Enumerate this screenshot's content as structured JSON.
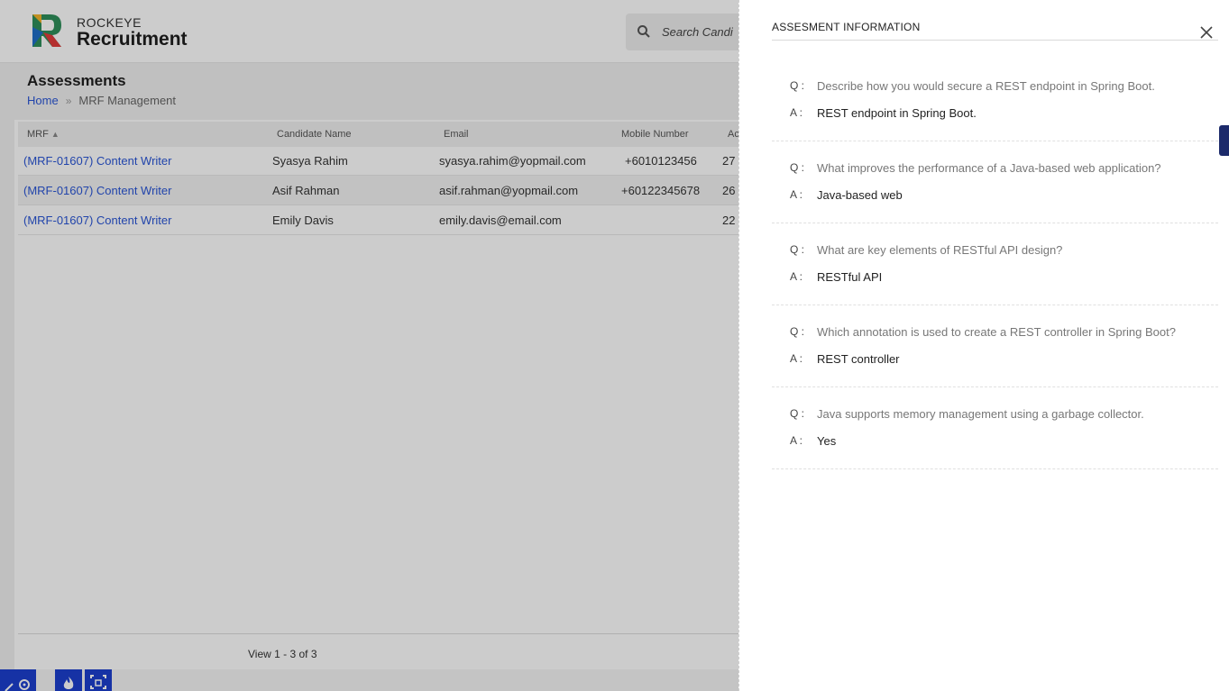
{
  "header": {
    "brand_top": "ROCKEYE",
    "brand_main": "Recruitment",
    "search_placeholder": "Search Candi"
  },
  "page": {
    "title": "Assessments",
    "breadcrumb": {
      "home": "Home",
      "current": "MRF Management"
    }
  },
  "table": {
    "columns": [
      "MRF",
      "Candidate Name",
      "Email",
      "Mobile Number",
      "Ac"
    ],
    "rows": [
      {
        "mrf": "(MRF-01607) Content Writer",
        "name": "Syasya Rahim",
        "email": "syasya.rahim@yopmail.com",
        "mobile": "+6010123456",
        "extra": "27 "
      },
      {
        "mrf": "(MRF-01607) Content Writer",
        "name": "Asif Rahman",
        "email": "asif.rahman@yopmail.com",
        "mobile": "+60122345678",
        "extra": "26 "
      },
      {
        "mrf": "(MRF-01607) Content Writer",
        "name": "Emily Davis",
        "email": "emily.davis@email.com",
        "mobile": "",
        "extra": "22 "
      }
    ],
    "pager": "View 1 - 3 of 3"
  },
  "drawer": {
    "title": "ASSESMENT INFORMATION",
    "q_label": "Q :",
    "a_label": "A :",
    "items": [
      {
        "q": "Describe how you would secure a REST endpoint in Spring Boot.",
        "a": "REST endpoint in Spring Boot."
      },
      {
        "q": "What improves the performance of a Java-based web application?",
        "a": "Java-based web"
      },
      {
        "q": "What are key elements of RESTful API design?",
        "a": "RESTful API"
      },
      {
        "q": "Which annotation is used to create a REST controller in Spring Boot?",
        "a": "REST controller"
      },
      {
        "q": "Java supports memory management using a garbage collector.",
        "a": "Yes"
      }
    ]
  },
  "colors": {
    "accent": "#2a56d6",
    "fab": "#1c3fcf"
  },
  "icons": [
    "search-icon",
    "sort-icon",
    "close-icon",
    "chevron-right-icon",
    "settings-icon",
    "fire-icon",
    "expand-icon"
  ]
}
